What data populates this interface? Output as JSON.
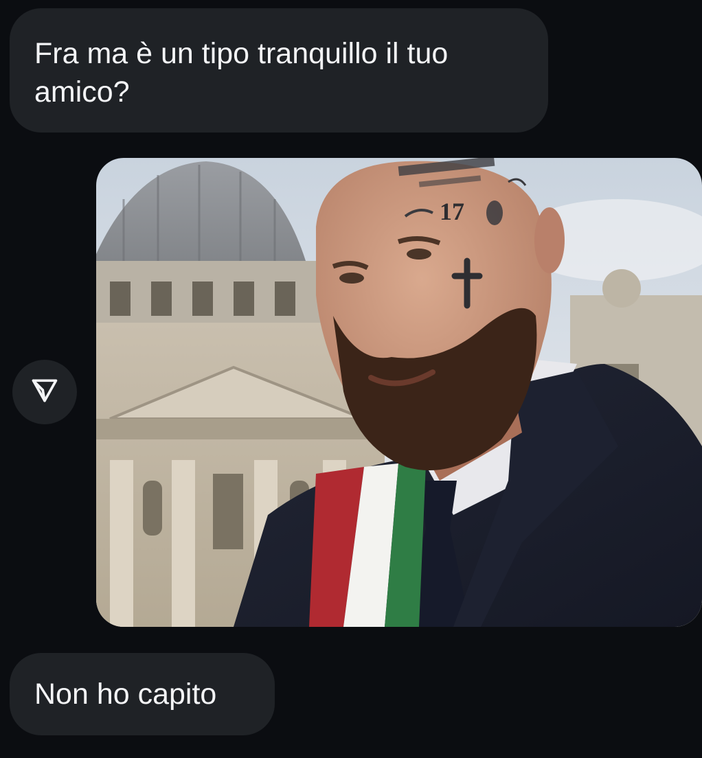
{
  "messages": [
    {
      "text": "Fra ma è un tipo tranquillo il tuo amico?",
      "type": "text"
    },
    {
      "type": "image",
      "alt": ""
    },
    {
      "text": "Non ho capito",
      "type": "text"
    }
  ],
  "photo": {
    "tattoo_number": "17"
  },
  "share_button": {
    "icon": "share-arrow-icon"
  },
  "colors": {
    "background": "#0b0d11",
    "bubble": "#1f2226",
    "text": "#f3f4f6"
  }
}
